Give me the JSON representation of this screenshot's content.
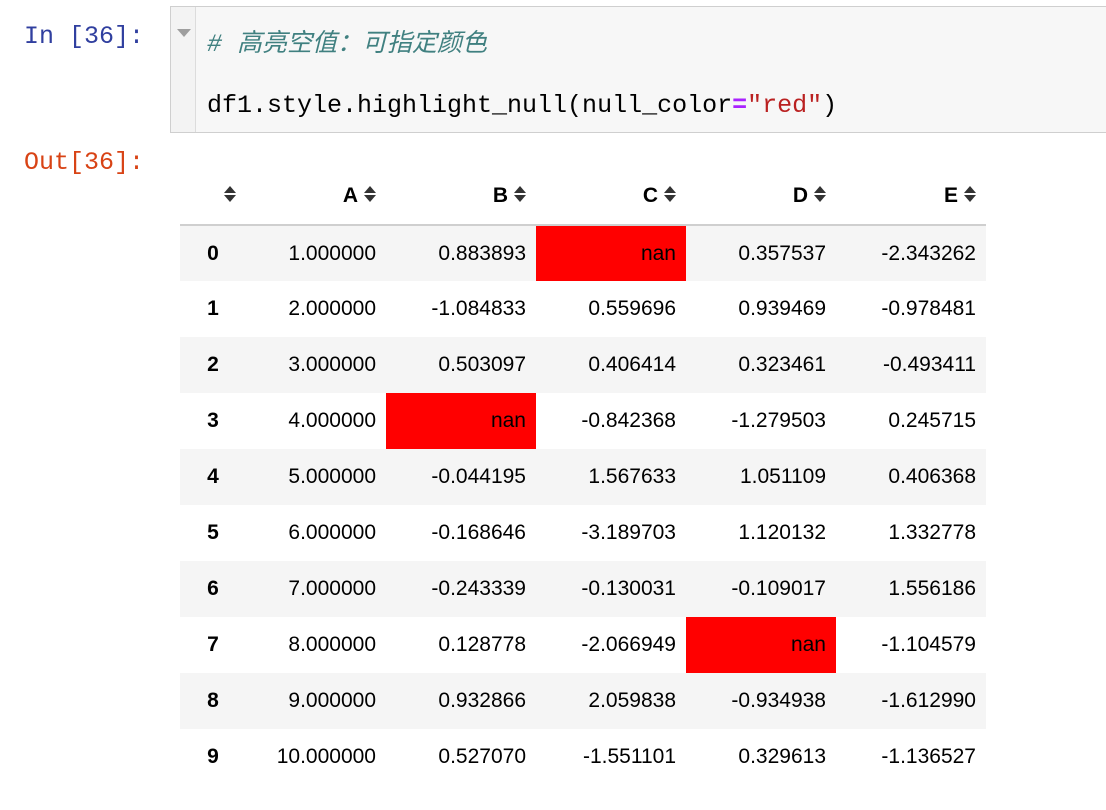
{
  "input_prompt": "In [36]:",
  "output_prompt": "Out[36]:",
  "code": {
    "comment": "# 高亮空值：可指定颜色",
    "line2_part1": "df1.style.highlight_null(null_color",
    "line2_op": "=",
    "line2_str": "\"red\"",
    "line2_part2": ")"
  },
  "table": {
    "columns": [
      "A",
      "B",
      "C",
      "D",
      "E"
    ],
    "index": [
      "0",
      "1",
      "2",
      "3",
      "4",
      "5",
      "6",
      "7",
      "8",
      "9"
    ],
    "highlight_color": "#ff0000",
    "rows": [
      [
        "1.000000",
        "0.883893",
        "nan",
        "0.357537",
        "-2.343262"
      ],
      [
        "2.000000",
        "-1.084833",
        "0.559696",
        "0.939469",
        "-0.978481"
      ],
      [
        "3.000000",
        "0.503097",
        "0.406414",
        "0.323461",
        "-0.493411"
      ],
      [
        "4.000000",
        "nan",
        "-0.842368",
        "-1.279503",
        "0.245715"
      ],
      [
        "5.000000",
        "-0.044195",
        "1.567633",
        "1.051109",
        "0.406368"
      ],
      [
        "6.000000",
        "-0.168646",
        "-3.189703",
        "1.120132",
        "1.332778"
      ],
      [
        "7.000000",
        "-0.243339",
        "-0.130031",
        "-0.109017",
        "1.556186"
      ],
      [
        "8.000000",
        "0.128778",
        "-2.066949",
        "nan",
        "-1.104579"
      ],
      [
        "9.000000",
        "0.932866",
        "2.059838",
        "-0.934938",
        "-1.612990"
      ],
      [
        "10.000000",
        "0.527070",
        "-1.551101",
        "0.329613",
        "-1.136527"
      ]
    ]
  }
}
